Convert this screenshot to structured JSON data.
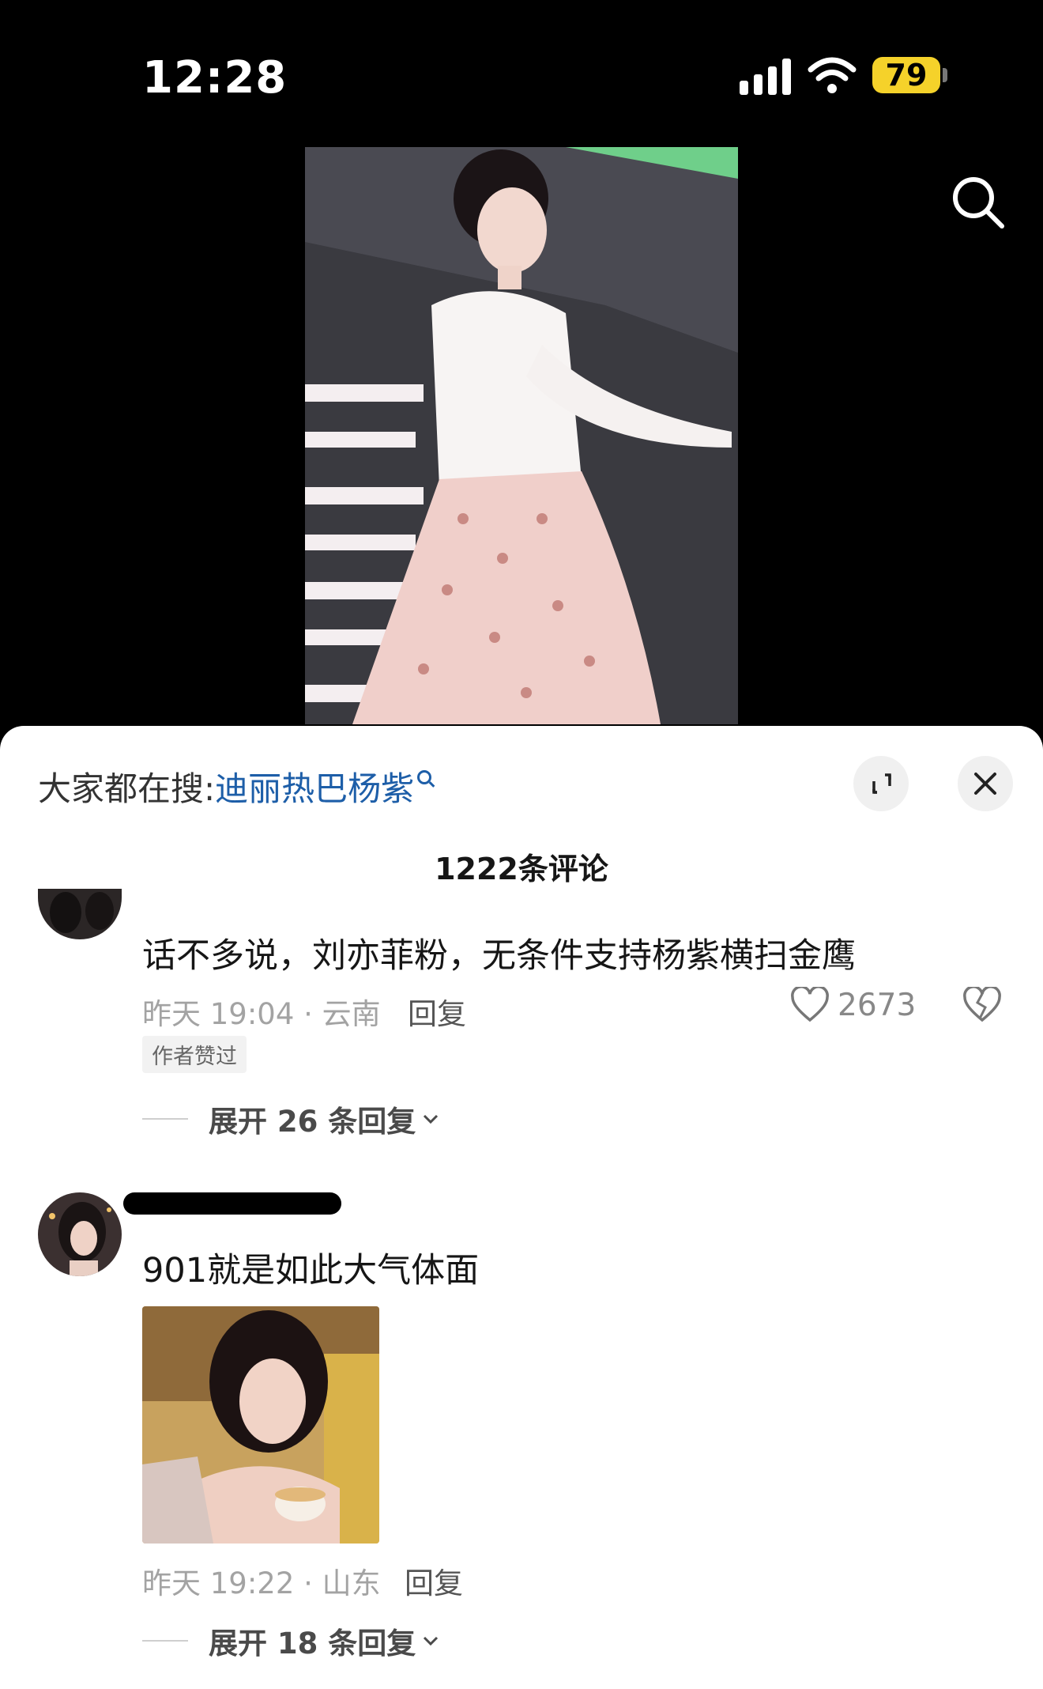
{
  "status_bar": {
    "time": "12:28",
    "battery": "79"
  },
  "sheet": {
    "hot_search_prefix": "大家都在搜:",
    "hot_search_keyword": "迪丽热巴杨紫",
    "comment_count": "1222条评论"
  },
  "comments": [
    {
      "text": "话不多说，刘亦菲粉，无条件支持杨紫横扫金鹰",
      "meta": "昨天 19:04 · 云南",
      "reply": "回复",
      "likes": "2673",
      "badge": "作者赞过",
      "expand": "展开 26 条回复"
    },
    {
      "text": "901就是如此大气体面",
      "meta": "昨天 19:22 · 山东",
      "reply": "回复",
      "expand": "展开 18 条回复"
    }
  ],
  "colors": {
    "accent_link": "#1d5ea8",
    "battery": "#f5d22a"
  },
  "icons": [
    "signal-icon",
    "wifi-icon",
    "search-icon",
    "expand-icon",
    "close-icon",
    "heart-icon",
    "broken-heart-icon",
    "chevron-down-icon"
  ]
}
